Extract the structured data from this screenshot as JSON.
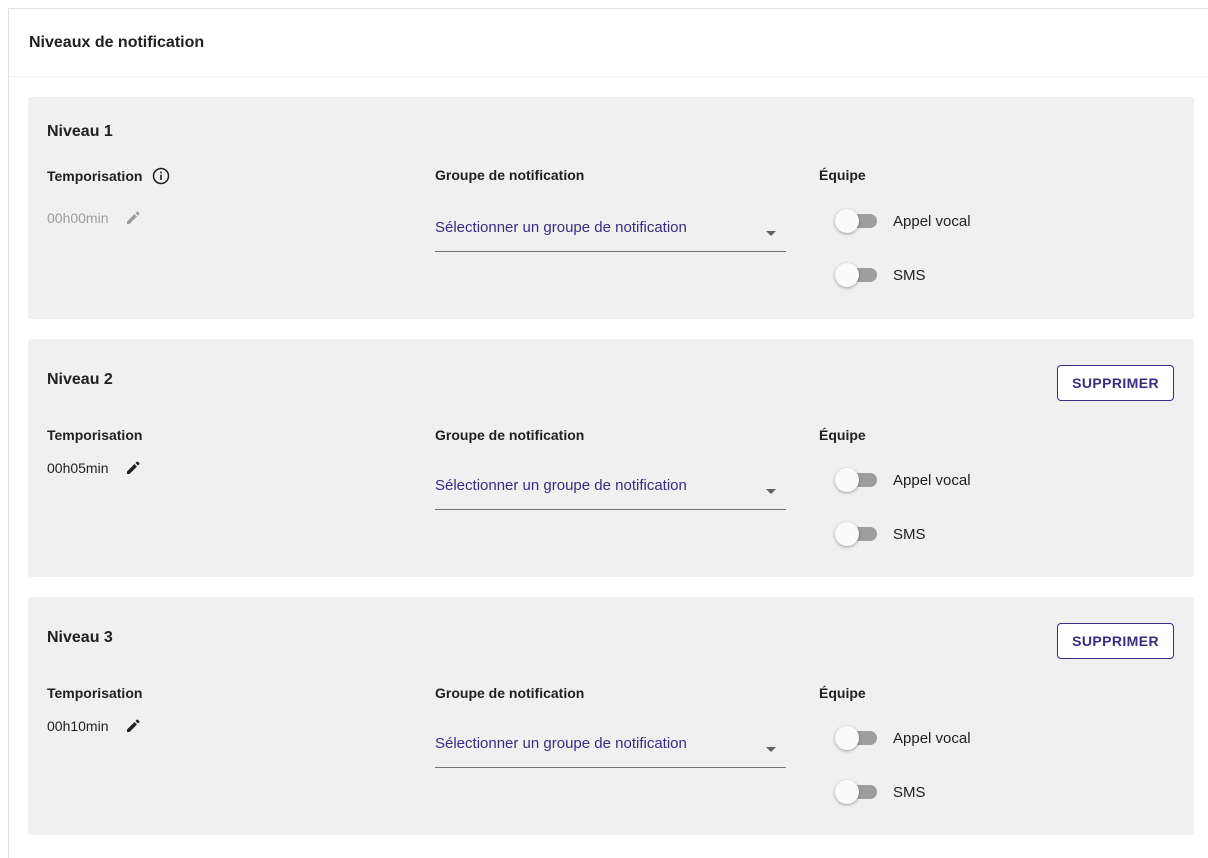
{
  "panel": {
    "title": "Niveaux de notification"
  },
  "labels": {
    "temporisation": "Temporisation",
    "group": "Groupe de notification",
    "team": "Équipe",
    "voice": "Appel vocal",
    "sms": "SMS",
    "delete": "SUPPRIMER",
    "group_placeholder": "Sélectionner un groupe de notification"
  },
  "levels": [
    {
      "title": "Niveau 1",
      "delay": "00h00min",
      "delay_editable": false,
      "has_info_icon": true,
      "deletable": false,
      "voice_enabled": false,
      "sms_enabled": false
    },
    {
      "title": "Niveau 2",
      "delay": "00h05min",
      "delay_editable": true,
      "has_info_icon": false,
      "deletable": true,
      "voice_enabled": false,
      "sms_enabled": false
    },
    {
      "title": "Niveau 3",
      "delay": "00h10min",
      "delay_editable": true,
      "has_info_icon": false,
      "deletable": true,
      "voice_enabled": false,
      "sms_enabled": false
    }
  ],
  "colors": {
    "accent": "#3c2b80",
    "card_background": "#f0f0f0",
    "disabled_text": "#9e9e9e",
    "switch_track_off": "#9e9e9e"
  },
  "icons": {
    "info": "info-icon",
    "edit": "pencil-icon",
    "dropdown": "caret-down-icon"
  }
}
